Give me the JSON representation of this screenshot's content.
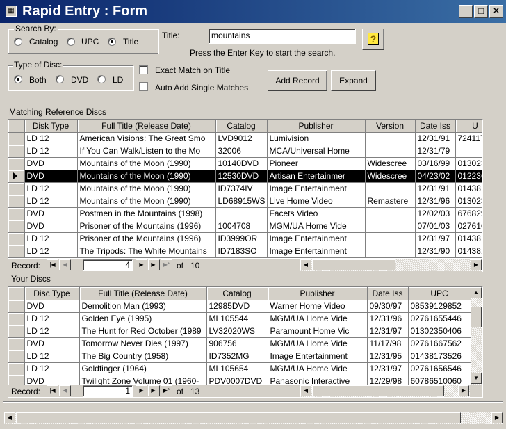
{
  "window": {
    "title": "Rapid Entry : Form",
    "minimize": "_",
    "maximize": "□",
    "close": "✕"
  },
  "search_by": {
    "legend": "Search By:",
    "options": [
      {
        "label": "Catalog",
        "selected": false
      },
      {
        "label": "UPC",
        "selected": false
      },
      {
        "label": "Title",
        "selected": true
      }
    ]
  },
  "search": {
    "label": "Title:",
    "value": "mountains",
    "hint": "Press the Enter Key to start the search.",
    "help_button": "?"
  },
  "disc_type": {
    "legend": "Type of Disc:",
    "options": [
      {
        "label": "Both",
        "selected": true
      },
      {
        "label": "DVD",
        "selected": false
      },
      {
        "label": "LD",
        "selected": false
      }
    ]
  },
  "options": {
    "exact_match": "Exact Match on Title",
    "auto_add": "Auto Add Single Matches"
  },
  "buttons": {
    "add_record": "Add Record",
    "expand": "Expand"
  },
  "matching": {
    "caption": "Matching Reference Discs",
    "columns": [
      "Disk Type",
      "Full Title (Release Date)",
      "Catalog",
      "Publisher",
      "Version",
      "Date Iss",
      "U"
    ],
    "rows": [
      [
        "LD 12",
        "American Visions: The Great Smo",
        "LVD9012",
        "Lumivision",
        "",
        "12/31/91",
        "724117"
      ],
      [
        "LD 12",
        "If You Can Walk/Listen to the Mo",
        "32006",
        "MCA/Universal Home",
        "",
        "12/31/79",
        ""
      ],
      [
        "DVD",
        "Mountains of the Moon (1990)",
        "10140DVD",
        "Pioneer",
        "Widescree",
        "03/16/99",
        "013023"
      ],
      [
        "DVD",
        "Mountains of the Moon (1990)",
        "12530DVD",
        "Artisan Entertainmer",
        "Widescree",
        "04/23/02",
        "012236"
      ],
      [
        "LD 12",
        "Mountains of the Moon (1990)",
        "ID7374IV",
        "Image Entertainment",
        "",
        "12/31/91",
        "014381"
      ],
      [
        "LD 12",
        "Mountains of the Moon (1990)",
        "LD68915WS",
        "Live Home Video",
        "Remastere",
        "12/31/96",
        "013023"
      ],
      [
        "DVD",
        "Postmen in the Mountains (1998)",
        "",
        "Facets Video",
        "",
        "12/02/03",
        "676829"
      ],
      [
        "DVD",
        "Prisoner of the Mountains (1996)",
        "1004708",
        "MGM/UA Home Vide",
        "",
        "07/01/03",
        "027616"
      ],
      [
        "LD 12",
        "Prisoner of the Mountains (1996)",
        "ID3999OR",
        "Image Entertainment",
        "",
        "12/31/97",
        "014381"
      ],
      [
        "LD 12",
        "The Tripods: The White Mountains",
        "ID7183SO",
        "Image Entertainment",
        "",
        "12/31/90",
        "014381"
      ]
    ],
    "current_row": 3,
    "nav": {
      "label": "Record:",
      "current": "4",
      "of": "of",
      "total": "10"
    }
  },
  "yours": {
    "caption": "Your Discs",
    "columns": [
      "Disc Type",
      "Full Title (Release Date)",
      "Catalog",
      "Publisher",
      "Date Iss",
      "UPC"
    ],
    "rows": [
      [
        "DVD",
        "Demolition Man (1993)",
        "12985DVD",
        "Warner Home Video",
        "09/30/97",
        "08539129852"
      ],
      [
        "LD 12",
        "Golden Eye (1995)",
        "ML105544",
        "MGM/UA Home Vide",
        "12/31/96",
        "02761655446"
      ],
      [
        "LD 12",
        "The Hunt for Red October (1989",
        "LV32020WS",
        "Paramount Home Vic",
        "12/31/97",
        "01302350406"
      ],
      [
        "DVD",
        "Tomorrow Never Dies (1997)",
        "906756",
        "MGM/UA Home Vide",
        "11/17/98",
        "02761667562"
      ],
      [
        "LD 12",
        "The Big Country (1958)",
        "ID7352MG",
        "Image Entertainment",
        "12/31/95",
        "01438173526"
      ],
      [
        "LD 12",
        "Goldfinger (1964)",
        "ML105654",
        "MGM/UA Home Vide",
        "12/31/97",
        "02761656546"
      ],
      [
        "DVD",
        "Twilight Zone Volume 01 (1960-",
        "PDV0007DVD",
        "Panasonic Interactive",
        "12/29/98",
        "60786510060"
      ]
    ],
    "nav": {
      "label": "Record:",
      "current": "1",
      "of": "of",
      "total": "13"
    }
  }
}
